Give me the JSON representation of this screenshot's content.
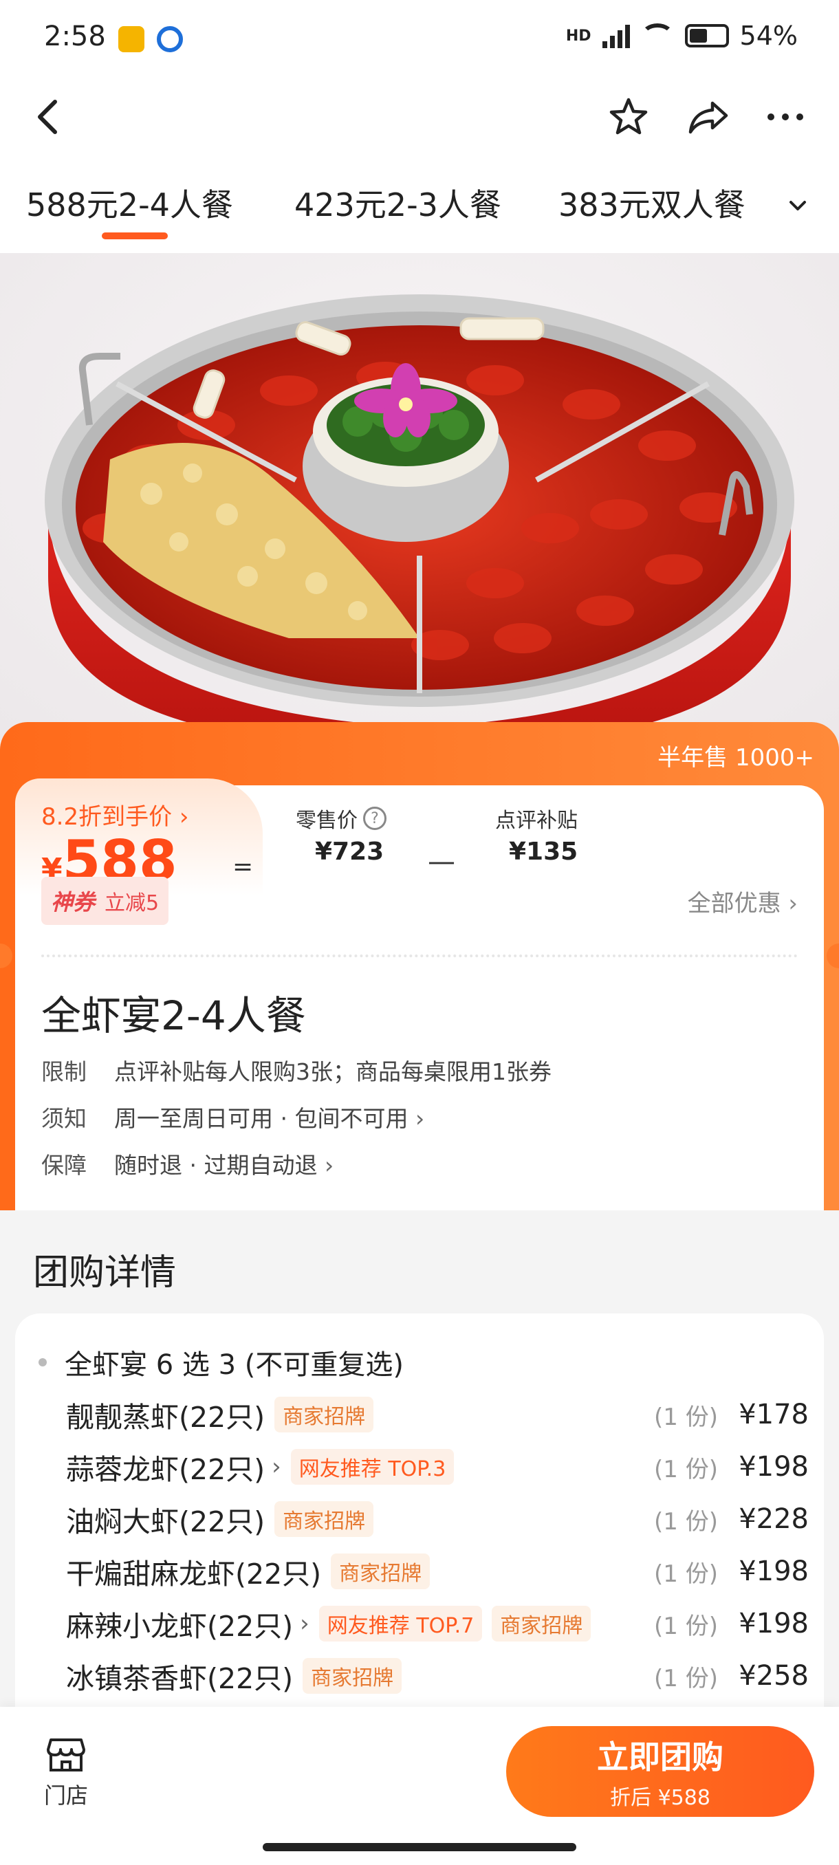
{
  "status": {
    "time": "2:58",
    "network": "HD",
    "battery": "54%"
  },
  "nav": {
    "back": "back-icon",
    "favorite": "star-icon",
    "share": "share-icon",
    "more": "more-icon"
  },
  "tabs": [
    {
      "label": "588元2-4人餐",
      "active": true
    },
    {
      "label": "423元2-3人餐",
      "active": false
    },
    {
      "label": "383元双人餐",
      "active": false
    }
  ],
  "price": {
    "half_year_sales": "半年售 1000+",
    "discount_text": "8.2折到手价 ›",
    "currency": "¥",
    "final": "588",
    "retail_label": "零售价",
    "retail_value": "¥723",
    "subsidy_label": "点评补贴",
    "subsidy_value": "¥135",
    "coupon_brand": "神券",
    "coupon_text": "立减5",
    "all_offers": "全部优惠 ›"
  },
  "product": {
    "title": "全虾宴2-4人餐",
    "rows": [
      {
        "key": "限制",
        "value": "点评补贴每人限购3张；商品每桌限用1张券",
        "chev": ""
      },
      {
        "key": "须知",
        "value": "周一至周日可用 · 包间不可用",
        "chev": "›"
      },
      {
        "key": "保障",
        "value": "随时退 · 过期自动退",
        "chev": "›"
      }
    ]
  },
  "group_buy": {
    "title": "团购详情",
    "header": "全虾宴 6 选 3 (不可重复选)",
    "items": [
      {
        "name": "靓靓蒸虾(22只)",
        "chev": "",
        "tags": [
          "商家招牌"
        ],
        "qty": "(1 份)",
        "price": "¥178"
      },
      {
        "name": "蒜蓉龙虾(22只)",
        "chev": "›",
        "tags": [
          "网友推荐 TOP.3"
        ],
        "qty": "(1 份)",
        "price": "¥198"
      },
      {
        "name": "油焖大虾(22只)",
        "chev": "",
        "tags": [
          "商家招牌"
        ],
        "qty": "(1 份)",
        "price": "¥228"
      },
      {
        "name": "干煸甜麻龙虾(22只)",
        "chev": "",
        "tags": [
          "商家招牌"
        ],
        "qty": "(1 份)",
        "price": "¥198"
      },
      {
        "name": "麻辣小龙虾(22只)",
        "chev": "›",
        "tags": [
          "网友推荐 TOP.7",
          "商家招牌"
        ],
        "qty": "(1 份)",
        "price": "¥198"
      },
      {
        "name": "冰镇茶香虾(22只)",
        "chev": "",
        "tags": [
          "商家招牌"
        ],
        "qty": "(1 份)",
        "price": "¥258"
      }
    ]
  },
  "bottom": {
    "store_label": "门店",
    "buy_label": "立即团购",
    "buy_sub": "折后 ¥588"
  },
  "colors": {
    "accent": "#ff5a1f",
    "accent_light": "#ff8a3a",
    "tag_bg": "#fdf0e7"
  }
}
